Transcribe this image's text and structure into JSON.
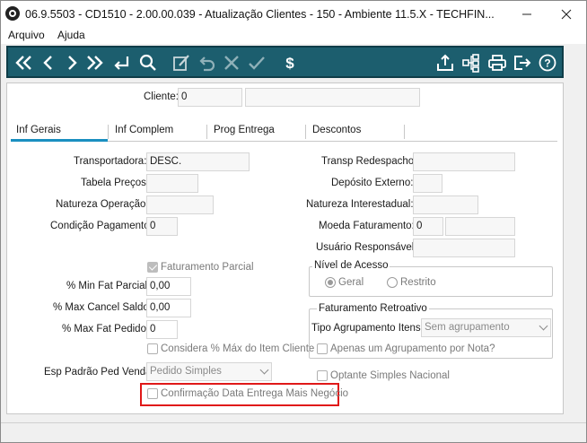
{
  "window": {
    "title": "06.9.5503 - CD1510 - 2.00.00.039 - Atualização Clientes - 150 - Ambiente 11.5.X - TECHFIN...",
    "icon": "totvs-logo-icon"
  },
  "menu": {
    "items": [
      "Arquivo",
      "Ajuda"
    ]
  },
  "toolbar": {
    "buttons": [
      "first-icon",
      "previous-icon",
      "next-icon",
      "last-icon",
      "goto-icon",
      "search-icon",
      "edit-icon",
      "undo-icon",
      "cancel-icon",
      "confirm-icon",
      "dollar-icon",
      "export-icon",
      "hierarchy-icon",
      "print-icon",
      "exit-icon",
      "help-icon"
    ],
    "colors": {
      "background": "#1c5e6e",
      "icon": "#ffffff"
    }
  },
  "header": {
    "cliente_label": "Cliente:",
    "cliente_value": "0",
    "cliente_name": ""
  },
  "tabs": [
    "Inf Gerais",
    "Inf Complem",
    "Prog Entrega",
    "Descontos"
  ],
  "left": {
    "transportadora_label": "Transportadora:",
    "transportadora_value": "DESC.",
    "tabela_precos_label": "Tabela Preços:",
    "tabela_precos_value": "",
    "natureza_operacao_label": "Natureza Operação:",
    "natureza_operacao_value": "",
    "condicao_pagamento_label": "Condição Pagamento:",
    "condicao_pagamento_value": "0",
    "faturamento_parcial_label": "Faturamento Parcial",
    "min_fat_parcial_label": "% Min Fat Parcial:",
    "min_fat_parcial_value": "0,00",
    "max_cancel_saldo_label": "% Max Cancel Saldo:",
    "max_cancel_saldo_value": "0,00",
    "max_fat_pedido_label": "% Max Fat Pedido:",
    "max_fat_pedido_value": "0",
    "considera_label": "Considera % Máx do Item Cliente",
    "esp_padrao_label": "Esp Padrão Ped Venda:",
    "esp_padrao_value": "Pedido Simples",
    "confirmacao_label": "Confirmação Data Entrega Mais Negócio"
  },
  "right": {
    "transp_redespacho_label": "Transp Redespacho:",
    "transp_redespacho_value": "",
    "deposito_externo_label": "Depósito Externo:",
    "deposito_externo_value": "",
    "natureza_interestadual_label": "Natureza Interestadual:",
    "natureza_interestadual_value": "",
    "moeda_faturamento_label": "Moeda Faturamento:",
    "moeda_faturamento_value": "0",
    "moeda_faturamento_desc": "",
    "usuario_responsavel_label": "Usuário Responsável:",
    "usuario_responsavel_value": "",
    "nivel_acesso_title": "Nível de Acesso",
    "geral_label": "Geral",
    "restrito_label": "Restrito",
    "faturamento_retroativo_title": "Faturamento Retroativo",
    "tipo_agrupamento_label": "Tipo Agrupamento Itens:",
    "tipo_agrupamento_value": "Sem agrupamento",
    "apenas_um_label": "Apenas um Agrupamento por Nota?",
    "optante_label": "Optante Simples Nacional"
  },
  "highlight_color": "#e01818"
}
